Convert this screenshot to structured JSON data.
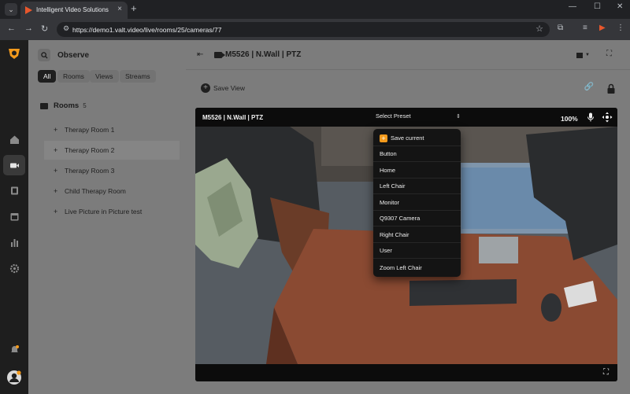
{
  "browser": {
    "tab_title": "Intelligent Video Solutions",
    "tab_close": "×",
    "new_tab": "+",
    "url": "https://demo1.valt.video/live/rooms/25/cameras/77",
    "win_min": "—",
    "win_max": "☐",
    "win_close": "✕"
  },
  "sidebar": {
    "title": "Observe",
    "filters": [
      "All",
      "Rooms",
      "Views",
      "Streams"
    ],
    "rooms_title": "Rooms",
    "rooms_count": "5",
    "rooms": [
      {
        "label": "Therapy Room 1"
      },
      {
        "label": "Therapy Room 2"
      },
      {
        "label": "Therapy Room 3"
      },
      {
        "label": "Child Therapy Room"
      },
      {
        "label": "Live Picture in Picture test"
      }
    ]
  },
  "main": {
    "camera_title": "M5526 | N.Wall | PTZ",
    "save_view_label": "Save View"
  },
  "player": {
    "title": "M5526 | N.Wall | PTZ",
    "preset_placeholder": "Select Preset",
    "zoom": "100%"
  },
  "presets": {
    "save_current": "Save current",
    "items": [
      "Button",
      "Home",
      "Left Chair",
      "Monitor",
      "Q9307 Camera",
      "Right Chair",
      "User",
      "Zoom Left Chair"
    ]
  },
  "colors": {
    "accent": "#f39a1c",
    "sidebar_bg": "#7c7c7c",
    "rail_bg": "#1e1e1e"
  }
}
